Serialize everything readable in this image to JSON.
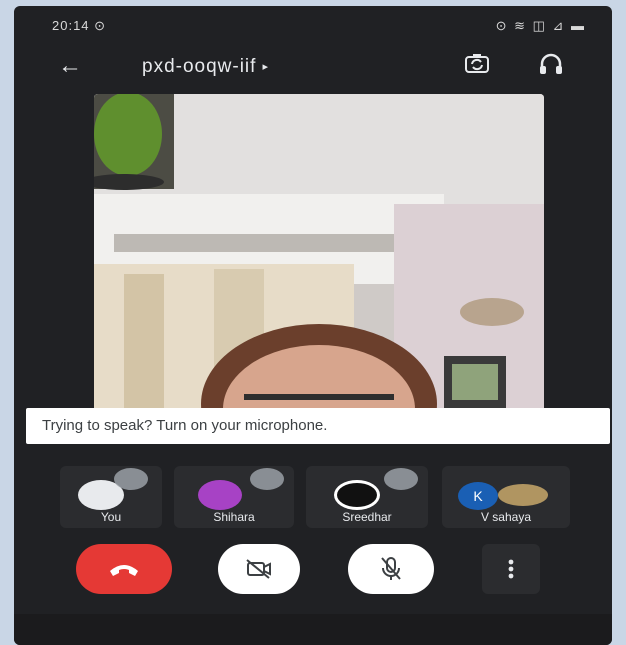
{
  "status_bar": {
    "time": "20:14 ⊙",
    "icons_text": "⊙ ≋ ◫ ⊿ ▬"
  },
  "header": {
    "meeting_code": "pxd-ooqw-iif",
    "caret": "▸"
  },
  "banner": {
    "text": "Trying to speak? Turn on your microphone."
  },
  "participants": [
    {
      "name": "You",
      "avatar_color": "#e8eaed"
    },
    {
      "name": "Shihara",
      "avatar_color": "#a742c5"
    },
    {
      "name": "Sreedhar",
      "avatar_color": "#111111"
    },
    {
      "name": "V sahaya",
      "avatar_color": "#1a5fb4"
    }
  ],
  "controls": {
    "end_call_icon": "phone-hangup-icon",
    "camera_icon": "camera-off-icon",
    "mic_icon": "mic-off-icon",
    "more_icon": "more-vertical-icon"
  },
  "colors": {
    "background": "#202124",
    "end_call": "#e53935",
    "banner_bg": "#ffffff"
  }
}
